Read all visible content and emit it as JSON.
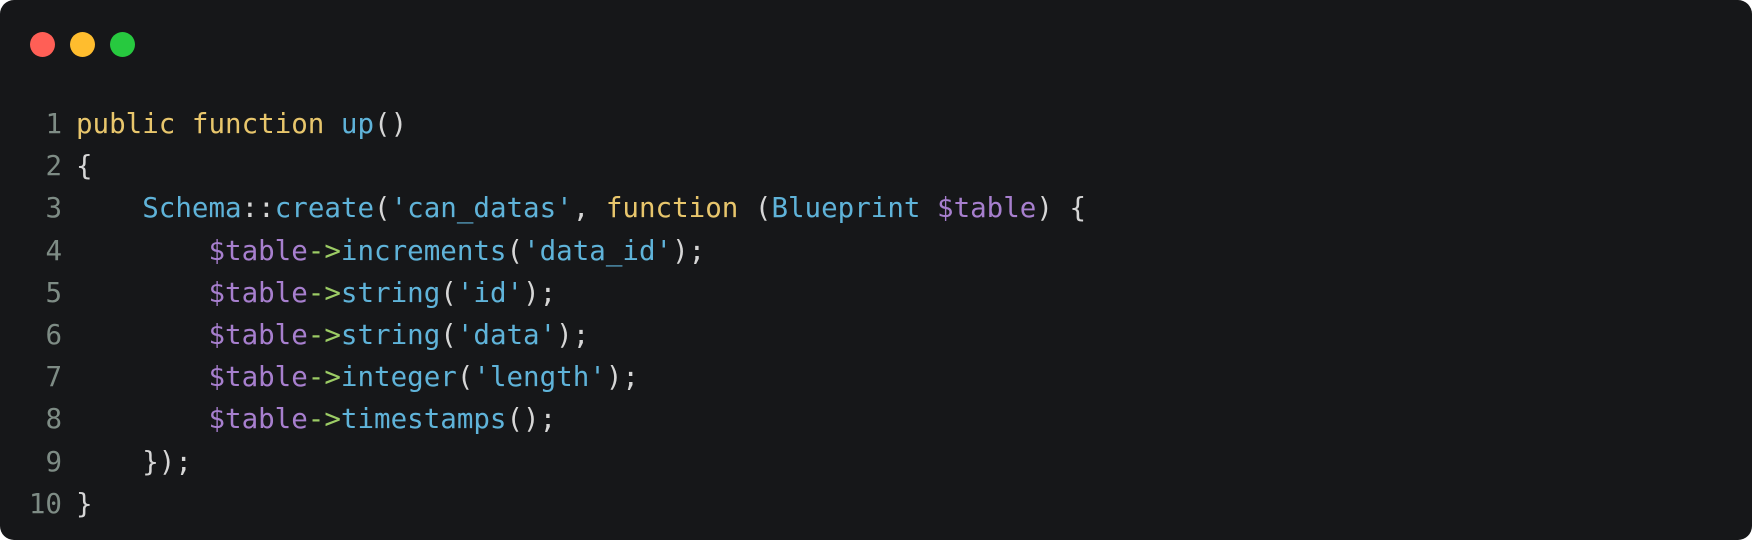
{
  "window": {
    "background": "#161719",
    "traffic_lights": [
      {
        "name": "close",
        "color": "#ff5f56"
      },
      {
        "name": "minimize",
        "color": "#ffbd2e"
      },
      {
        "name": "zoom",
        "color": "#27c93f"
      }
    ]
  },
  "colors": {
    "keyword": "#e8c66c",
    "function": "#5fb3d9",
    "string": "#5fb3d9",
    "variable": "#a77fce",
    "arrow": "#9ccc65",
    "punct": "#d6d6d6",
    "line_number": "#7e8c85"
  },
  "code": {
    "language": "php",
    "lines": [
      {
        "n": "1",
        "tokens": [
          {
            "t": "public",
            "c": "keyword"
          },
          {
            "t": " ",
            "c": "punct"
          },
          {
            "t": "function",
            "c": "keyword"
          },
          {
            "t": " ",
            "c": "punct"
          },
          {
            "t": "up",
            "c": "function"
          },
          {
            "t": "()",
            "c": "punct"
          }
        ]
      },
      {
        "n": "2",
        "tokens": [
          {
            "t": "{",
            "c": "punct"
          }
        ]
      },
      {
        "n": "3",
        "tokens": [
          {
            "t": "    ",
            "c": "punct"
          },
          {
            "t": "Schema",
            "c": "function"
          },
          {
            "t": "::",
            "c": "punct"
          },
          {
            "t": "create",
            "c": "function"
          },
          {
            "t": "(",
            "c": "punct"
          },
          {
            "t": "'can_datas'",
            "c": "string"
          },
          {
            "t": ", ",
            "c": "punct"
          },
          {
            "t": "function",
            "c": "keyword"
          },
          {
            "t": " (",
            "c": "punct"
          },
          {
            "t": "Blueprint",
            "c": "function"
          },
          {
            "t": " ",
            "c": "punct"
          },
          {
            "t": "$table",
            "c": "variable"
          },
          {
            "t": ") {",
            "c": "punct"
          }
        ]
      },
      {
        "n": "4",
        "tokens": [
          {
            "t": "        ",
            "c": "punct"
          },
          {
            "t": "$table",
            "c": "variable"
          },
          {
            "t": "->",
            "c": "arrow"
          },
          {
            "t": "increments",
            "c": "function"
          },
          {
            "t": "(",
            "c": "punct"
          },
          {
            "t": "'data_id'",
            "c": "string"
          },
          {
            "t": ");",
            "c": "punct"
          }
        ]
      },
      {
        "n": "5",
        "tokens": [
          {
            "t": "        ",
            "c": "punct"
          },
          {
            "t": "$table",
            "c": "variable"
          },
          {
            "t": "->",
            "c": "arrow"
          },
          {
            "t": "string",
            "c": "function"
          },
          {
            "t": "(",
            "c": "punct"
          },
          {
            "t": "'id'",
            "c": "string"
          },
          {
            "t": ");",
            "c": "punct"
          }
        ]
      },
      {
        "n": "6",
        "tokens": [
          {
            "t": "        ",
            "c": "punct"
          },
          {
            "t": "$table",
            "c": "variable"
          },
          {
            "t": "->",
            "c": "arrow"
          },
          {
            "t": "string",
            "c": "function"
          },
          {
            "t": "(",
            "c": "punct"
          },
          {
            "t": "'data'",
            "c": "string"
          },
          {
            "t": ");",
            "c": "punct"
          }
        ]
      },
      {
        "n": "7",
        "tokens": [
          {
            "t": "        ",
            "c": "punct"
          },
          {
            "t": "$table",
            "c": "variable"
          },
          {
            "t": "->",
            "c": "arrow"
          },
          {
            "t": "integer",
            "c": "function"
          },
          {
            "t": "(",
            "c": "punct"
          },
          {
            "t": "'length'",
            "c": "string"
          },
          {
            "t": ");",
            "c": "punct"
          }
        ]
      },
      {
        "n": "8",
        "tokens": [
          {
            "t": "        ",
            "c": "punct"
          },
          {
            "t": "$table",
            "c": "variable"
          },
          {
            "t": "->",
            "c": "arrow"
          },
          {
            "t": "timestamps",
            "c": "function"
          },
          {
            "t": "();",
            "c": "punct"
          }
        ]
      },
      {
        "n": "9",
        "tokens": [
          {
            "t": "    ",
            "c": "punct"
          },
          {
            "t": "});",
            "c": "punct"
          }
        ]
      },
      {
        "n": "10",
        "tokens": [
          {
            "t": "}",
            "c": "punct"
          }
        ]
      }
    ]
  }
}
